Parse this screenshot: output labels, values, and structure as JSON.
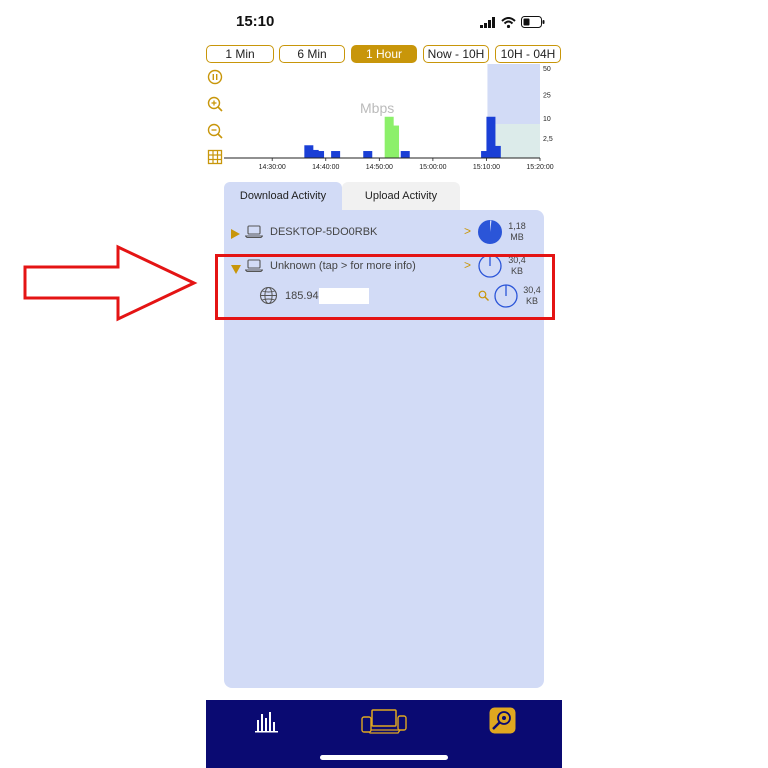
{
  "status_bar": {
    "time": "15:10"
  },
  "time_ranges": [
    {
      "label": "1 Min",
      "active": false
    },
    {
      "label": "6 Min",
      "active": false
    },
    {
      "label": "1 Hour",
      "active": true
    },
    {
      "label": "Now - 10H",
      "active": false
    },
    {
      "label": "10H - 04H",
      "active": false
    }
  ],
  "chart_data": {
    "type": "bar",
    "title": "Mbps",
    "xlabel": "",
    "ylabel": "",
    "x_ticks": [
      "14:30:00",
      "14:40:00",
      "14:50:00",
      "15:00:00",
      "15:10:00",
      "15:20:00"
    ],
    "y_ticks": [
      "50",
      "25",
      "10",
      "2,5"
    ],
    "series": [
      {
        "color": "#1a3fd6",
        "bars": [
          {
            "t": "14:36:00",
            "v": 1.0
          },
          {
            "t": "14:37:00",
            "v": 0.4
          },
          {
            "t": "14:38:00",
            "v": 0.3
          },
          {
            "t": "14:41:00",
            "v": 0.3
          },
          {
            "t": "14:47:00",
            "v": 0.3
          },
          {
            "t": "14:52:00",
            "v": 0.5
          },
          {
            "t": "14:54:00",
            "v": 0.3
          },
          {
            "t": "15:09:00",
            "v": 0.3
          },
          {
            "t": "15:10:00",
            "v": 10.5
          },
          {
            "t": "15:11:00",
            "v": 0.9
          }
        ]
      },
      {
        "color": "#8cf06a",
        "bars": [
          {
            "t": "14:51:00",
            "v": 10.5
          },
          {
            "t": "14:52:00",
            "v": 6.5
          }
        ]
      }
    ]
  },
  "tabs": {
    "download": "Download Activity",
    "upload": "Upload Activity"
  },
  "devices": [
    {
      "name": "DESKTOP-5DO0RBK",
      "size_value": "1,18",
      "size_unit": "MB"
    },
    {
      "name": "Unknown (tap > for more info)",
      "size_value": "30,4",
      "size_unit": "KB"
    }
  ],
  "sub_item": {
    "ip": "185.94.",
    "size_value": "30,4",
    "size_unit": "KB"
  },
  "colors": {
    "accent": "#c8960a",
    "panel": "#d2dbf6",
    "tabbar": "#0a0a72",
    "highlight": "#e41414"
  }
}
